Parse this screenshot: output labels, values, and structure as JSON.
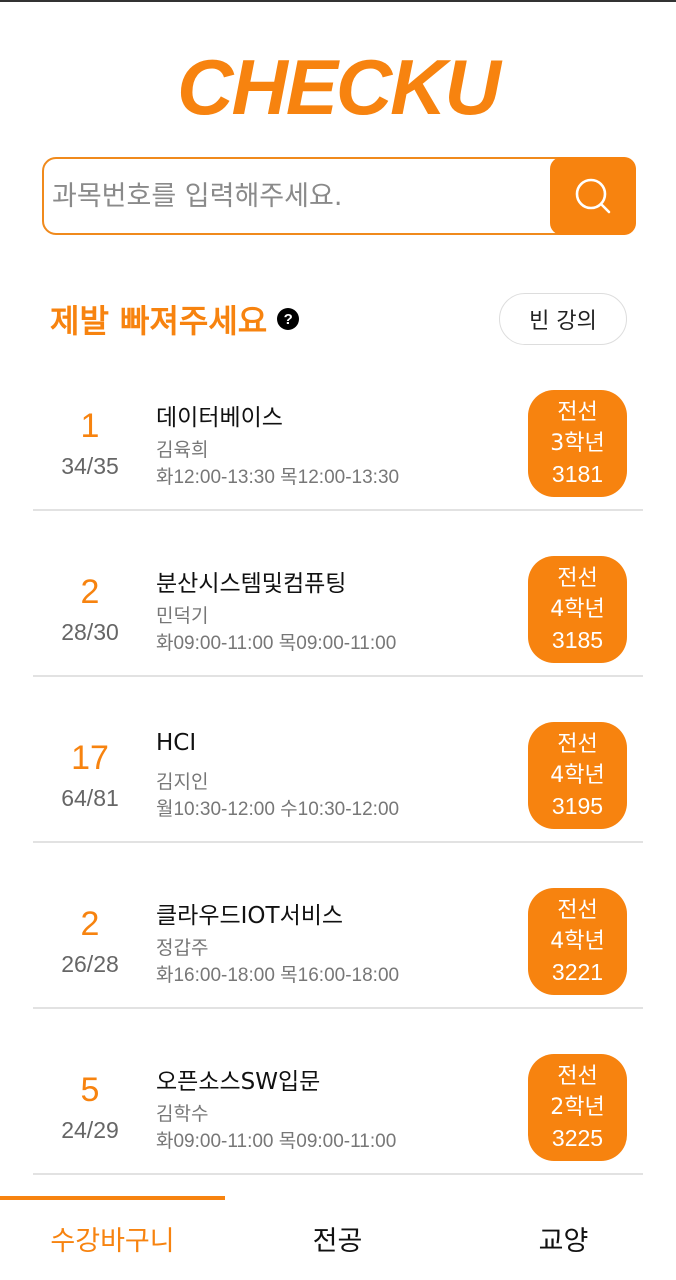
{
  "app": {
    "logo": "CHECKU"
  },
  "search": {
    "placeholder": "과목번호를 입력해주세요."
  },
  "section": {
    "title": "제발 빠져주세요",
    "help": "?",
    "empty_button": "빈 강의"
  },
  "courses": [
    {
      "rank": "1",
      "capacity": "34/35",
      "name": "데이터베이스",
      "professor": "김육희",
      "schedule": "화12:00-13:30 목12:00-13:30",
      "category": "전선",
      "grade": "3학년",
      "code": "3181"
    },
    {
      "rank": "2",
      "capacity": "28/30",
      "name": "분산시스템및컴퓨팅",
      "professor": "민덕기",
      "schedule": "화09:00-11:00 목09:00-11:00",
      "category": "전선",
      "grade": "4학년",
      "code": "3185"
    },
    {
      "rank": "17",
      "capacity": "64/81",
      "name": "HCI",
      "professor": "김지인",
      "schedule": "월10:30-12:00 수10:30-12:00",
      "category": "전선",
      "grade": "4학년",
      "code": "3195"
    },
    {
      "rank": "2",
      "capacity": "26/28",
      "name": "클라우드IOT서비스",
      "professor": "정갑주",
      "schedule": "화16:00-18:00 목16:00-18:00",
      "category": "전선",
      "grade": "4학년",
      "code": "3221"
    },
    {
      "rank": "5",
      "capacity": "24/29",
      "name": "오픈소스SW입문",
      "professor": "김학수",
      "schedule": "화09:00-11:00 목09:00-11:00",
      "category": "전선",
      "grade": "2학년",
      "code": "3225"
    }
  ],
  "tabs": [
    {
      "label": "수강바구니",
      "active": true
    },
    {
      "label": "전공",
      "active": false
    },
    {
      "label": "교양",
      "active": false
    }
  ],
  "colors": {
    "accent": "#f7830f",
    "muted_text": "#777777",
    "divider": "#e2e2e2"
  }
}
